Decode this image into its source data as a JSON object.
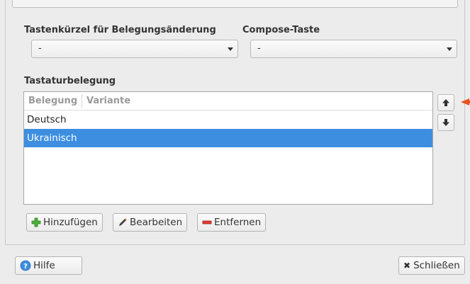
{
  "shortcut": {
    "label": "Tastenkürzel für Belegungsänderung",
    "value": "-"
  },
  "compose": {
    "label": "Compose-Taste",
    "value": "-"
  },
  "layout": {
    "title": "Tastaturbelegung",
    "columns": [
      "Belegung",
      "Variante"
    ],
    "rows": [
      {
        "belegung": "Deutsch",
        "variante": "",
        "selected": false
      },
      {
        "belegung": "Ukrainisch",
        "variante": "",
        "selected": true
      }
    ]
  },
  "actions": {
    "add": "Hinzufügen",
    "edit": "Bearbeiten",
    "remove": "Entfernen"
  },
  "footer": {
    "help": "Hilfe",
    "close": "Schließen"
  },
  "colors": {
    "selection": "#3d8ee1",
    "pointer": "#e8541f"
  },
  "icons": {
    "up": "arrow-up-icon",
    "down": "arrow-down-icon",
    "add": "plus-icon",
    "edit": "pencil-icon",
    "remove": "minus-icon",
    "help": "help-icon",
    "close": "close-icon"
  }
}
